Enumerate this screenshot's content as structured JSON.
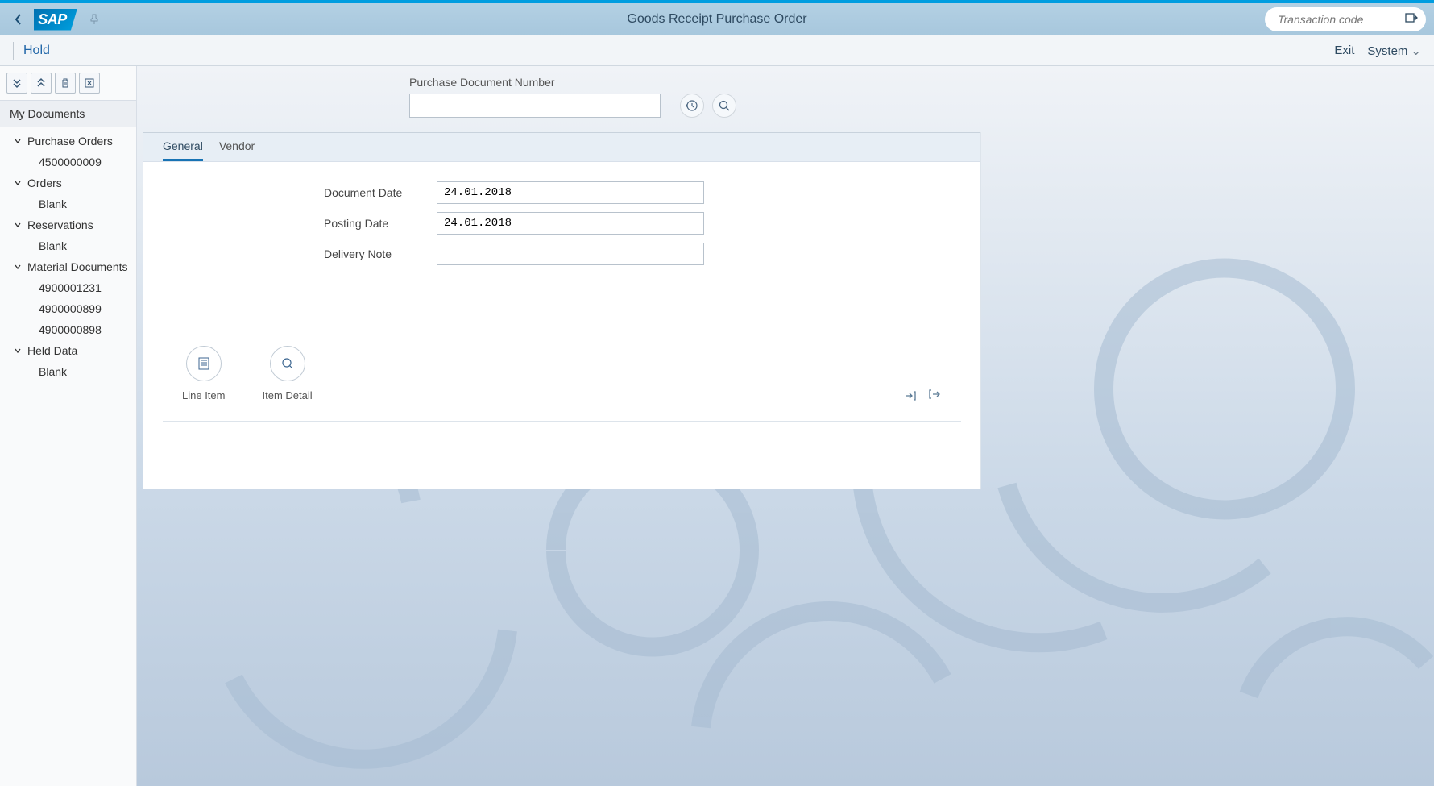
{
  "header": {
    "sap_logo": "SAP",
    "page_title": "Goods Receipt Purchase Order",
    "transaction_placeholder": "Transaction code"
  },
  "subheader": {
    "hold_label": "Hold",
    "exit_label": "Exit",
    "system_label": "System"
  },
  "sidebar": {
    "my_documents_label": "My Documents",
    "groups": [
      {
        "label": "Purchase Orders",
        "items": [
          "4500000009"
        ]
      },
      {
        "label": "Orders",
        "items": [
          "Blank"
        ]
      },
      {
        "label": "Reservations",
        "items": [
          "Blank"
        ]
      },
      {
        "label": "Material Documents",
        "items": [
          "4900001231",
          "4900000899",
          "4900000898"
        ]
      },
      {
        "label": "Held Data",
        "items": [
          "Blank"
        ]
      }
    ]
  },
  "doc_num": {
    "label": "Purchase Document Number",
    "value": ""
  },
  "tabs": {
    "general": "General",
    "vendor": "Vendor"
  },
  "form": {
    "doc_date_label": "Document Date",
    "doc_date_value": "24.01.2018",
    "posting_date_label": "Posting Date",
    "posting_date_value": "24.01.2018",
    "delivery_note_label": "Delivery Note",
    "delivery_note_value": ""
  },
  "actions": {
    "line_item_label": "Line Item",
    "item_detail_label": "Item Detail"
  }
}
